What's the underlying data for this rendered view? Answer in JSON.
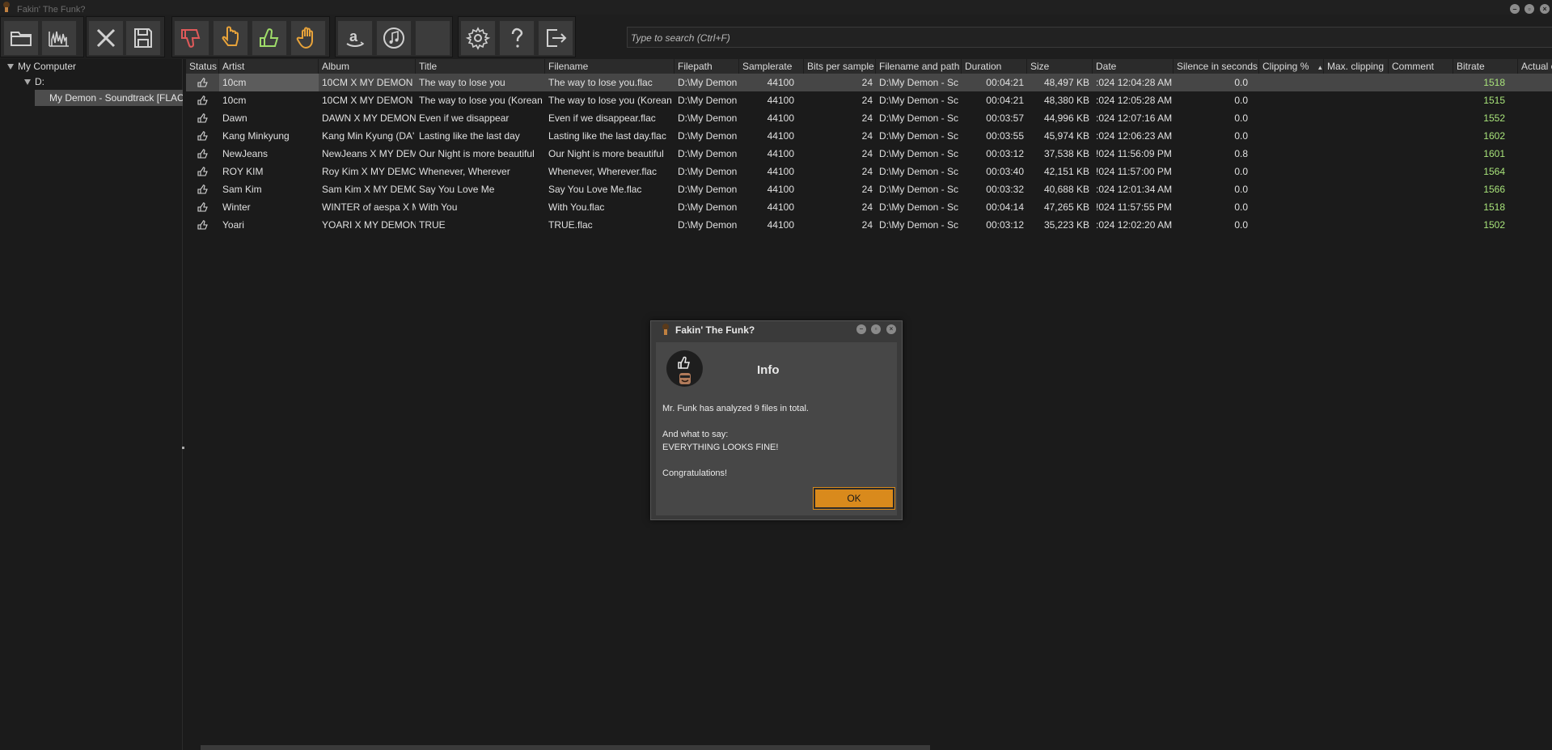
{
  "app": {
    "title": "Fakin' The Funk?"
  },
  "toolbar": {
    "buttons": [
      {
        "name": "open-folder-button",
        "icon": "folder-icon"
      },
      {
        "name": "spectrum-button",
        "icon": "spectrum-icon"
      },
      {
        "name": "remove-button",
        "icon": "close-icon"
      },
      {
        "name": "save-button",
        "icon": "save-icon"
      },
      {
        "name": "mark-bad-button",
        "icon": "thumbs-down-icon"
      },
      {
        "name": "mark-suspicious-button",
        "icon": "pointing-hand-icon"
      },
      {
        "name": "mark-good-button",
        "icon": "thumbs-up-icon"
      },
      {
        "name": "mark-stop-button",
        "icon": "stop-hand-icon"
      },
      {
        "name": "amazon-button",
        "icon": "amazon-icon"
      },
      {
        "name": "itunes-button",
        "icon": "music-note-icon"
      },
      {
        "name": "empty-button",
        "icon": ""
      },
      {
        "name": "settings-button",
        "icon": "gear-icon"
      },
      {
        "name": "help-button",
        "icon": "question-icon"
      },
      {
        "name": "exit-button",
        "icon": "exit-icon"
      }
    ],
    "search_placeholder": "Type to search (Ctrl+F)"
  },
  "tree": {
    "root": "My Computer",
    "drive": "D:",
    "folder": "My Demon - Soundtrack [FLAC]"
  },
  "table": {
    "columns": [
      "Status",
      "Artist",
      "Album",
      "Title",
      "Filename",
      "Filepath",
      "Samplerate",
      "Bits per sample",
      "Filename and path",
      "Duration",
      "Size",
      "Date",
      "Silence in seconds",
      "Clipping %",
      "Max. clipping",
      "Comment",
      "Bitrate",
      "Actual c"
    ],
    "rows": [
      {
        "status": "thumbs-up-icon",
        "artist": "10cm",
        "album": "10CM X MY DEMON",
        "title": "The way to lose you",
        "filename": "The way to lose you.flac",
        "filepath": "D:\\My Demon",
        "samplerate": "44100",
        "bits": "24",
        "fullpath": "D:\\My Demon - Sc",
        "duration": "00:04:21",
        "size": "48,497 KB",
        "date": ":024 12:04:28 AM",
        "silence": "0.0",
        "bitrate": "1518"
      },
      {
        "status": "thumbs-up-icon",
        "artist": "10cm",
        "album": "10CM X MY DEMON",
        "title": "The way to lose you (Korean",
        "filename": "The way to lose you (Korean",
        "filepath": "D:\\My Demon",
        "samplerate": "44100",
        "bits": "24",
        "fullpath": "D:\\My Demon - Sc",
        "duration": "00:04:21",
        "size": "48,380 KB",
        "date": ":024 12:05:28 AM",
        "silence": "0.0",
        "bitrate": "1515"
      },
      {
        "status": "thumbs-up-icon",
        "artist": "Dawn",
        "album": "DAWN X MY DEMON",
        "title": "Even if we disappear",
        "filename": "Even if we disappear.flac",
        "filepath": "D:\\My Demon",
        "samplerate": "44100",
        "bits": "24",
        "fullpath": "D:\\My Demon - Sc",
        "duration": "00:03:57",
        "size": "44,996 KB",
        "date": ":024 12:07:16 AM",
        "silence": "0.0",
        "bitrate": "1552"
      },
      {
        "status": "thumbs-up-icon",
        "artist": "Kang Minkyung",
        "album": "Kang Min Kyung (DA'",
        "title": "Lasting like the last day",
        "filename": "Lasting like the last day.flac",
        "filepath": "D:\\My Demon",
        "samplerate": "44100",
        "bits": "24",
        "fullpath": "D:\\My Demon - Sc",
        "duration": "00:03:55",
        "size": "45,974 KB",
        "date": ":024 12:06:23 AM",
        "silence": "0.0",
        "bitrate": "1602"
      },
      {
        "status": "thumbs-up-icon",
        "artist": "NewJeans",
        "album": "NewJeans X MY DEM",
        "title": "Our Night is more beautiful",
        "filename": "Our Night is more beautiful",
        "filepath": "D:\\My Demon",
        "samplerate": "44100",
        "bits": "24",
        "fullpath": "D:\\My Demon - Sc",
        "duration": "00:03:12",
        "size": "37,538 KB",
        "date": "!024 11:56:09 PM",
        "silence": "0.8",
        "bitrate": "1601"
      },
      {
        "status": "thumbs-up-icon",
        "artist": "ROY KIM",
        "album": "Roy Kim X MY DEMC",
        "title": "Whenever, Wherever",
        "filename": "Whenever, Wherever.flac",
        "filepath": "D:\\My Demon",
        "samplerate": "44100",
        "bits": "24",
        "fullpath": "D:\\My Demon - Sc",
        "duration": "00:03:40",
        "size": "42,151 KB",
        "date": "!024 11:57:00 PM",
        "silence": "0.0",
        "bitrate": "1564"
      },
      {
        "status": "thumbs-up-icon",
        "artist": "Sam Kim",
        "album": "Sam Kim X MY DEMC",
        "title": "Say You Love Me",
        "filename": "Say You Love Me.flac",
        "filepath": "D:\\My Demon",
        "samplerate": "44100",
        "bits": "24",
        "fullpath": "D:\\My Demon - Sc",
        "duration": "00:03:32",
        "size": "40,688 KB",
        "date": ":024 12:01:34 AM",
        "silence": "0.0",
        "bitrate": "1566"
      },
      {
        "status": "thumbs-up-icon",
        "artist": "Winter",
        "album": "WINTER of aespa X M",
        "title": "With You",
        "filename": "With You.flac",
        "filepath": "D:\\My Demon",
        "samplerate": "44100",
        "bits": "24",
        "fullpath": "D:\\My Demon - Sc",
        "duration": "00:04:14",
        "size": "47,265 KB",
        "date": "!024 11:57:55 PM",
        "silence": "0.0",
        "bitrate": "1518"
      },
      {
        "status": "thumbs-up-icon",
        "artist": "Yoari",
        "album": "YOARI X MY DEMON",
        "title": "TRUE",
        "filename": "TRUE.flac",
        "filepath": "D:\\My Demon",
        "samplerate": "44100",
        "bits": "24",
        "fullpath": "D:\\My Demon - Sc",
        "duration": "00:03:12",
        "size": "35,223 KB",
        "date": ":024 12:02:20 AM",
        "silence": "0.0",
        "bitrate": "1502"
      }
    ]
  },
  "dialog": {
    "title": "Fakin' The Funk?",
    "heading": "Info",
    "line1": "Mr. Funk has analyzed 9 files in total.",
    "line2": "And what to say:",
    "line3": "EVERYTHING LOOKS FINE!",
    "line4": "Congratulations!",
    "ok_label": "OK"
  },
  "colors": {
    "accent": "#d98a1c",
    "bitrate": "#a8e37a",
    "selected_row": "#464646"
  }
}
